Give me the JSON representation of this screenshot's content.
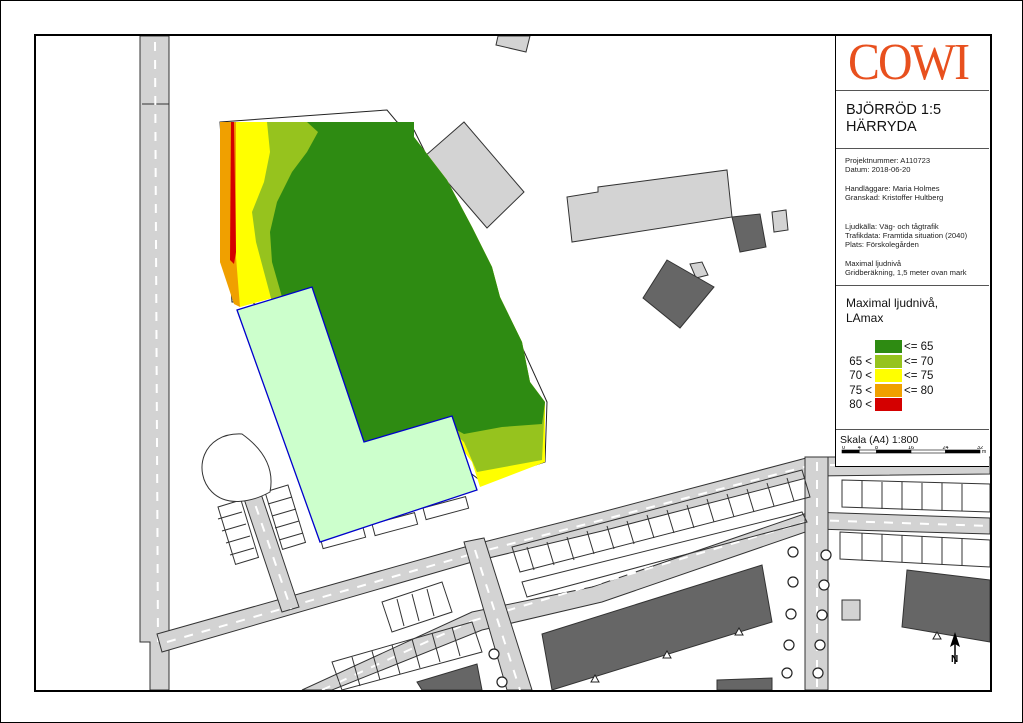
{
  "logo": {
    "text": "COWI",
    "color": "#e8501e"
  },
  "project": {
    "title_line1": "BJÖRRÖD 1:5",
    "title_line2": "HÄRRYDA"
  },
  "info": {
    "project_number": "Projektnummer: A110723",
    "date": "Datum: 2018-06-20",
    "handler": "Handläggare: Maria Holmes",
    "reviewer": "Granskad: Kristoffer Hultberg",
    "source": "Ljudkälla: Väg- och tågtrafik",
    "traffic": "Trafikdata: Framtida situation (2040)",
    "place": "Plats: Förskolegården",
    "metric": "Maximal ljudnivå",
    "grid": "Gridberäkning, 1,5 meter ovan mark"
  },
  "legend": {
    "title_line1": "Maximal ljudnivå,",
    "title_line2": "LAmax",
    "items": [
      {
        "lower": "",
        "upper": "<= 65",
        "color": "#2e8b12"
      },
      {
        "lower": "65 <",
        "upper": "<= 70",
        "color": "#96c31e"
      },
      {
        "lower": "70 <",
        "upper": "<= 75",
        "color": "#ffff00"
      },
      {
        "lower": "75 <",
        "upper": "<= 80",
        "color": "#f0a000"
      },
      {
        "lower": "80 <",
        "upper": "",
        "color": "#d40000"
      }
    ]
  },
  "scale": {
    "label": "Skala (A4) 1:800",
    "ticks": [
      "0",
      "4",
      "8",
      "16",
      "24",
      "32"
    ],
    "unit": "m"
  },
  "north_arrow": {
    "label": "N"
  },
  "map_colors": {
    "building_light": "#d3d3d3",
    "building_dark": "#666666",
    "schoolyard": "#ccffcc",
    "schoolyard_outline": "#0000cc",
    "road": "#d3d3d3"
  }
}
